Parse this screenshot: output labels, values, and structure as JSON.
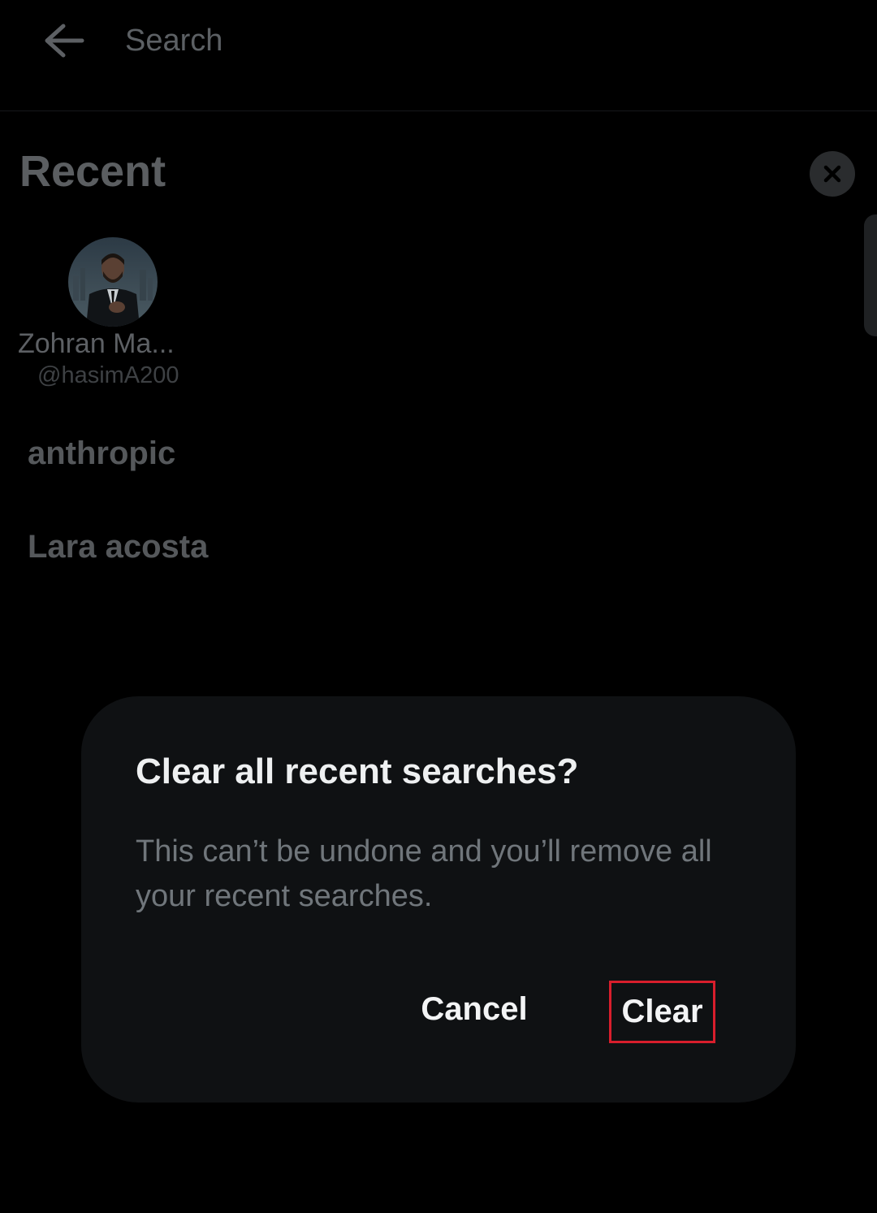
{
  "header": {
    "search_placeholder": "Search",
    "back_icon": "arrow-left-icon"
  },
  "recent": {
    "title": "Recent",
    "clear_icon": "close-icon",
    "user": {
      "name": "Zohran Ma...",
      "handle": "@hasimA200"
    },
    "terms": [
      "anthropic",
      "Lara acosta"
    ]
  },
  "dialog": {
    "title": "Clear all recent searches?",
    "message": "This can’t be undone and you’ll remove all your recent searches.",
    "cancel_label": "Cancel",
    "clear_label": "Clear",
    "highlight_color": "#d81e2c"
  }
}
